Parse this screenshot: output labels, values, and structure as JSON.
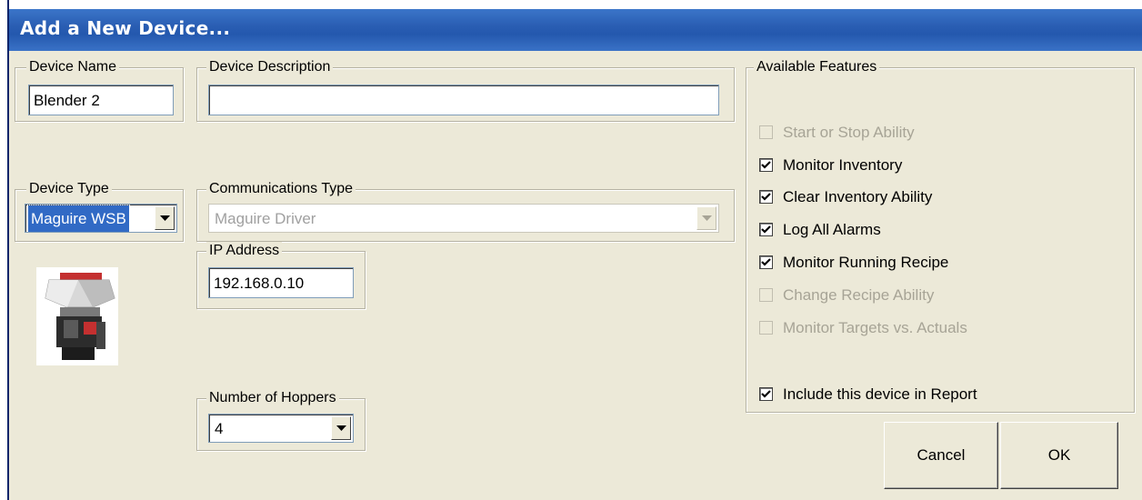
{
  "window": {
    "title": "Add a New Device..."
  },
  "device_name": {
    "label": "Device Name",
    "value": "Blender 2"
  },
  "device_description": {
    "label": "Device Description",
    "value": ""
  },
  "device_type": {
    "label": "Device Type",
    "value": "Maguire WSB"
  },
  "communications_type": {
    "label": "Communications Type",
    "value": "Maguire Driver"
  },
  "ip_address": {
    "label": "IP Address",
    "value": "192.168.0.10"
  },
  "number_of_hoppers": {
    "label": "Number of Hoppers",
    "value": "4"
  },
  "available_features": {
    "label": "Available Features",
    "items": [
      {
        "label": "Start or Stop Ability",
        "checked": false,
        "enabled": false
      },
      {
        "label": "Monitor Inventory",
        "checked": true,
        "enabled": true
      },
      {
        "label": "Clear Inventory Ability",
        "checked": true,
        "enabled": true
      },
      {
        "label": "Log All Alarms",
        "checked": true,
        "enabled": true
      },
      {
        "label": "Monitor Running Recipe",
        "checked": true,
        "enabled": true
      },
      {
        "label": "Change Recipe Ability",
        "checked": false,
        "enabled": false
      },
      {
        "label": "Monitor Targets vs. Actuals",
        "checked": false,
        "enabled": false
      }
    ],
    "include_in_report": {
      "label": "Include this device in Report",
      "checked": true,
      "enabled": true
    }
  },
  "buttons": {
    "cancel": "Cancel",
    "ok": "OK"
  },
  "colors": {
    "titlebar": "#2a5eb3",
    "dialog_bg": "#ece9d8",
    "selection": "#316ac5"
  }
}
